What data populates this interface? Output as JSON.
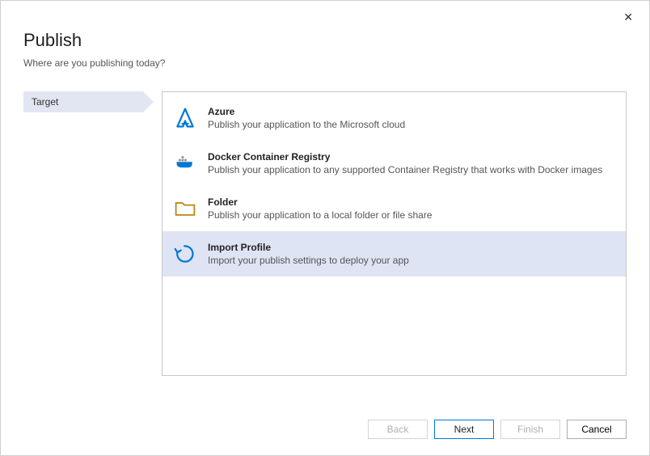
{
  "window": {
    "title": "Publish",
    "subtitle": "Where are you publishing today?",
    "close_glyph": "✕"
  },
  "steps": [
    {
      "label": "Target",
      "active": true
    }
  ],
  "options": [
    {
      "id": "azure",
      "title": "Azure",
      "desc": "Publish your application to the Microsoft cloud",
      "selected": false
    },
    {
      "id": "docker",
      "title": "Docker Container Registry",
      "desc": "Publish your application to any supported Container Registry that works with Docker images",
      "selected": false
    },
    {
      "id": "folder",
      "title": "Folder",
      "desc": "Publish your application to a local folder or file share",
      "selected": false
    },
    {
      "id": "import",
      "title": "Import Profile",
      "desc": "Import your publish settings to deploy your app",
      "selected": true
    }
  ],
  "footer": {
    "back": "Back",
    "next": "Next",
    "finish": "Finish",
    "cancel": "Cancel"
  }
}
